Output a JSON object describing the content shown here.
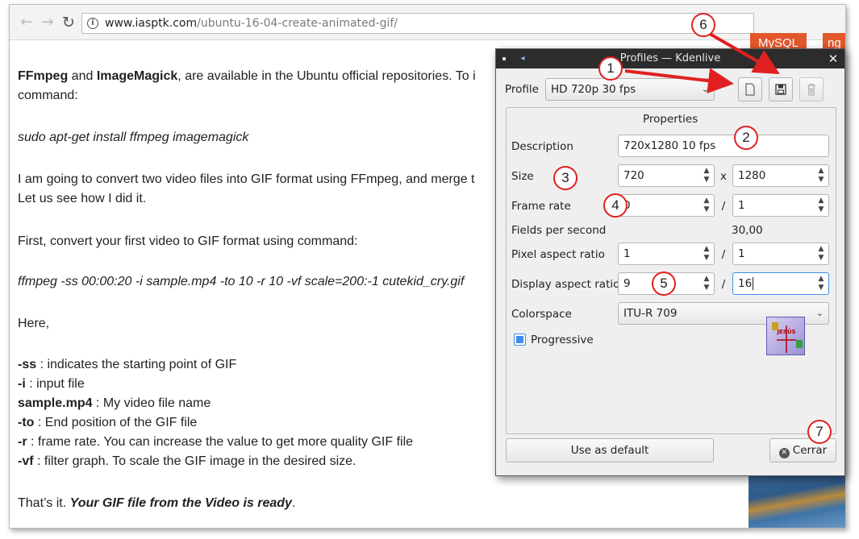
{
  "browser": {
    "url_host": "www.iasptk.com",
    "url_path": "/ubuntu-16-04-create-animated-gif/",
    "back_icon": "arrow-left",
    "forward_icon": "arrow-right",
    "reload_icon": "reload",
    "site_tabs": [
      "MySQL",
      "ng"
    ]
  },
  "article": {
    "p1_bold1": "FFmpeg",
    "p1_and": " and ",
    "p1_bold2": "ImageMagick",
    "p1_rest": ", are available in the Ubuntu official repositories. To i",
    "p1_line2": "command:",
    "cmd1": "sudo apt-get install ffmpeg imagemagick",
    "p2_line1": "I am going to convert two video files into GIF format using FFmpeg, and merge t",
    "p2_line2": "Let us see how I did it.",
    "p3": "First, convert your first video to GIF format using command:",
    "cmd2": "ffmpeg -ss 00:00:20 -i sample.mp4 -to 10 -r 10 -vf scale=200:-1 cutekid_cry.gif",
    "here": "Here,",
    "params": [
      {
        "key": "-ss",
        "desc": " : indicates the starting point of GIF"
      },
      {
        "key": "-i",
        "desc": " : input file"
      },
      {
        "key": "sample.mp4",
        "desc": " : My video file name"
      },
      {
        "key": "-to",
        "desc": " : End position of the GIF file"
      },
      {
        "key": "-r",
        "desc": " : frame rate. You can increase the value to get more quality GIF file"
      },
      {
        "key": "-vf",
        "desc": " : filter graph. To scale the GIF image in the desired size."
      }
    ],
    "end_plain": "That’s it. ",
    "end_bolditalic": "Your GIF file from the Video is ready",
    "end_dot": "."
  },
  "dialog": {
    "title": "Profiles — Kdenlive",
    "close_glyph": "✕",
    "profile_label": "Profile",
    "profile_value": "HD 720p 30 fps",
    "properties_title": "Properties",
    "description_label": "Description",
    "description_value": "720x1280 10 fps",
    "size_label": "Size",
    "size_width": "720",
    "size_sep": "x",
    "size_height": "1280",
    "frame_rate_label": "Frame rate",
    "frame_rate_num": "0",
    "frame_rate_sep": "/",
    "frame_rate_den": "1",
    "fields_label": "Fields per second",
    "fields_value": "30,00",
    "par_label": "Pixel aspect ratio",
    "par_num": "1",
    "par_sep": "/",
    "par_den": "1",
    "dar_label": "Display aspect ratio",
    "dar_num": "9",
    "dar_sep": "/",
    "dar_den": "16",
    "colorspace_label": "Colorspace",
    "colorspace_value": "ITU-R 709",
    "progressive_label": "Progressive",
    "progressive_checked": true,
    "use_default_label": "Use as default",
    "close_label": "Cerrar",
    "logo_text": "JESÚS"
  },
  "annotations": {
    "badges": [
      "1",
      "2",
      "3",
      "4",
      "5",
      "6",
      "7"
    ],
    "color": "#e02020"
  },
  "colors": {
    "accent": "#3d8ee8",
    "titlebar": "#2c2c2c",
    "annotation_red": "#e02020",
    "site_orange": "#e2572b"
  }
}
